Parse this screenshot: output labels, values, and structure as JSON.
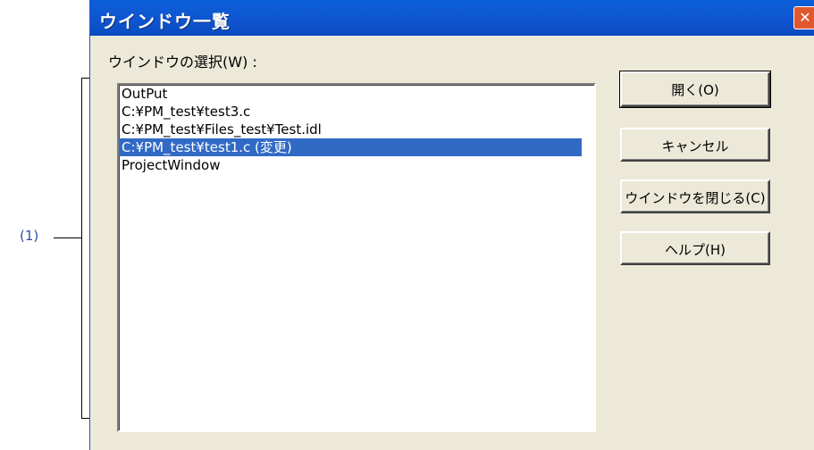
{
  "annotation": {
    "label": "(1)"
  },
  "dialog": {
    "title": "ウインドウ一覧",
    "close_symbol": "✕",
    "list_label": "ウインドウの選択(W) :",
    "items": [
      {
        "text": "OutPut"
      },
      {
        "text": "C:¥PM_test¥test3.c"
      },
      {
        "text": "C:¥PM_test¥Files_test¥Test.idl"
      },
      {
        "text": "C:¥PM_test¥test1.c (変更)"
      },
      {
        "text": "ProjectWindow"
      }
    ],
    "selected_index": 3,
    "buttons": {
      "open": "開く(O)",
      "cancel": "キャンセル",
      "close_window": "ウインドウを閉じる(C)",
      "help": "ヘルプ(H)"
    }
  },
  "colors": {
    "titlebar": "#0a55d0",
    "selection": "#316ac5",
    "dialog_bg": "#ece9d8",
    "annotation": "#2e4fa3"
  }
}
